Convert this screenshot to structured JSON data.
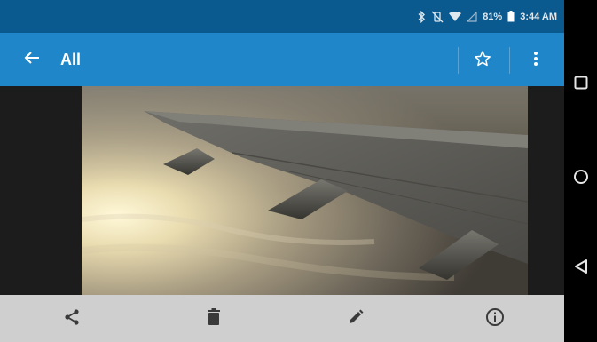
{
  "status_bar": {
    "battery_text": "81%",
    "time": "3:44 AM",
    "icons": [
      "bluetooth-icon",
      "vibrate-off-icon",
      "wifi-icon",
      "cell-signal-icon",
      "battery-icon"
    ]
  },
  "app_bar": {
    "title": "All",
    "back_icon": "arrow-back-icon",
    "star_icon": "star-outline-icon",
    "more_icon": "more-vert-icon"
  },
  "bottom_bar": {
    "actions": [
      "share-icon",
      "delete-icon",
      "edit-icon",
      "info-icon"
    ]
  },
  "nav_bar": {
    "buttons": [
      "recents-square-icon",
      "home-circle-icon",
      "back-triangle-icon"
    ]
  },
  "colors": {
    "status_bar": "#0b5a8f",
    "app_bar": "#1f86c9",
    "bottom_bar": "#cfcfcf",
    "nav_bar": "#000000"
  }
}
